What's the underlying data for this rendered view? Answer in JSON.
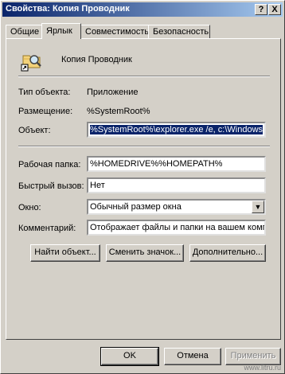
{
  "window": {
    "title": "Свойства: Копия Проводник",
    "help_glyph": "?",
    "close_glyph": "X"
  },
  "tabs": [
    {
      "label": "Общие"
    },
    {
      "label": "Ярлык",
      "active": true
    },
    {
      "label": "Совместимость"
    },
    {
      "label": "Безопасность"
    }
  ],
  "shortcut": {
    "name": "Копия Проводник",
    "icon": "explorer-folder-icon"
  },
  "info": {
    "type_label": "Тип объекта:",
    "type_value": "Приложение",
    "location_label": "Размещение:",
    "location_value": "%SystemRoot%"
  },
  "fields": {
    "target_label": "Объект:",
    "target_value": "%SystemRoot%\\explorer.exe /e, c:\\Windows",
    "startin_label": "Рабочая папка:",
    "startin_value": "%HOMEDRIVE%%HOMEPATH%",
    "hotkey_label": "Быстрый вызов:",
    "hotkey_value": "Нет",
    "run_label": "Окно:",
    "run_value": "Обычный размер окна",
    "comment_label": "Комментарий:",
    "comment_value": "Отображает файлы и папки на вашем компью"
  },
  "buttons": {
    "find_target": "Найти объект...",
    "change_icon": "Сменить значок...",
    "advanced": "Дополнительно...",
    "ok": "OK",
    "cancel": "Отмена",
    "apply": "Применить"
  },
  "watermark": "www.litru.ru"
}
